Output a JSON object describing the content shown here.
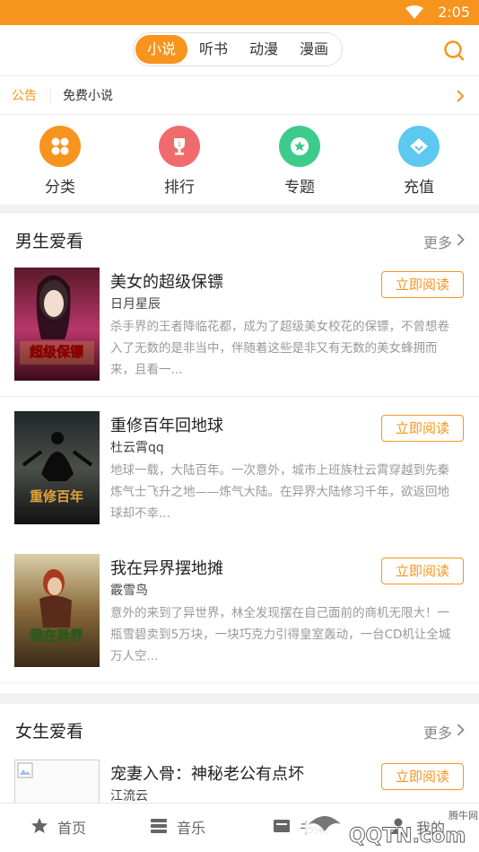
{
  "status_bar": {
    "time": "2:05"
  },
  "top_tabs": [
    "小说",
    "听书",
    "动漫",
    "漫画"
  ],
  "active_tab": "小说",
  "notice": {
    "tag": "公告",
    "text": "免费小说"
  },
  "quick_links": [
    {
      "label": "分类",
      "icon": "grid-icon",
      "color": "#f7941d"
    },
    {
      "label": "排行",
      "icon": "trophy-icon",
      "color": "#f06c6c"
    },
    {
      "label": "专题",
      "icon": "star-badge-icon",
      "color": "#3ccb8b"
    },
    {
      "label": "充值",
      "icon": "diamond-icon",
      "color": "#5dc8f0"
    }
  ],
  "male_section": {
    "title": "男生爱看",
    "more": "更多",
    "books": [
      {
        "title": "美女的超级保镖",
        "author": "日月星辰",
        "desc": "杀手界的王者降临花都，成为了超级美女校花的保镖，不曾想卷入了无数的是非当中，伴随着这些是非又有无数的美女蜂拥而来，且看一...",
        "button": "立即阅读",
        "cover_text": "超级保镖"
      },
      {
        "title": "重修百年回地球",
        "author": "杜云霄qq",
        "desc": "地球一载，大陆百年。一次意外，城市上班族杜云霄穿越到先秦炼气士飞升之地——炼气大陆。在异界大陆修习千年，欲返回地球却不幸...",
        "button": "立即阅读",
        "cover_text": "重修百年"
      },
      {
        "title": "我在异界摆地摊",
        "author": "霰雪鸟",
        "desc": "意外的来到了异世界，林全发现摆在自己面前的商机无限大！一瓶雪碧卖到5万块，一块巧克力引得皇室轰动，一台CD机让全城万人空...",
        "button": "立即阅读",
        "cover_text": "我在异界"
      }
    ]
  },
  "female_section": {
    "title": "女生爱看",
    "more": "更多",
    "books": [
      {
        "title": "宠妻入骨：神秘老公有点坏",
        "author": "江流云",
        "button": "立即阅读"
      }
    ]
  },
  "bottom_nav": [
    "首页",
    "音乐",
    "书架",
    "我的"
  ],
  "watermark": {
    "site": "腾牛网",
    "brand": "QQTN.com"
  }
}
